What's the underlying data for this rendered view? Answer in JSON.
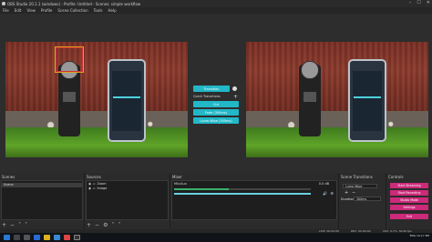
{
  "window": {
    "title": "OBS Studio 20.1.1 (windows) - Profile: Untitled - Scenes: simple workflow"
  },
  "menu": [
    "File",
    "Edit",
    "View",
    "Profile",
    "Scene Collection",
    "Tools",
    "Help"
  ],
  "transition_panel": {
    "transition_button": "Transition",
    "quick_label": "Quick Transitions",
    "cut": "Cut",
    "fade": "Fade (300ms)",
    "luma": "Luma Wipe (300ms)"
  },
  "panels": {
    "scenes": {
      "title": "Scenes",
      "items": [
        "Scene"
      ]
    },
    "sources": {
      "title": "Sources",
      "items": [
        "Zoom",
        "Image"
      ]
    },
    "mixer": {
      "title": "Mixer",
      "track": "Mic/Aux",
      "db": "0.0 dB"
    },
    "scene_transitions": {
      "title": "Scene Transitions",
      "transition": "Luma Wipe",
      "duration_label": "Duration",
      "duration": "300ms"
    },
    "controls": {
      "title": "Controls",
      "buttons": [
        "Start Streaming",
        "Start Recording",
        "Studio Mode",
        "Settings",
        "Exit"
      ]
    }
  },
  "status": {
    "live": "LIVE: 00:00:00",
    "rec": "REC: 00:00:00",
    "cpu": "CPU: 0.7%, 30.00 fps"
  },
  "taskbar": {
    "lang": "ENG",
    "time": "10:17 PM"
  },
  "colors": {
    "accent": "#22b8c8",
    "recording": "#cc2a7a",
    "scene_frame": "#e0a020"
  }
}
